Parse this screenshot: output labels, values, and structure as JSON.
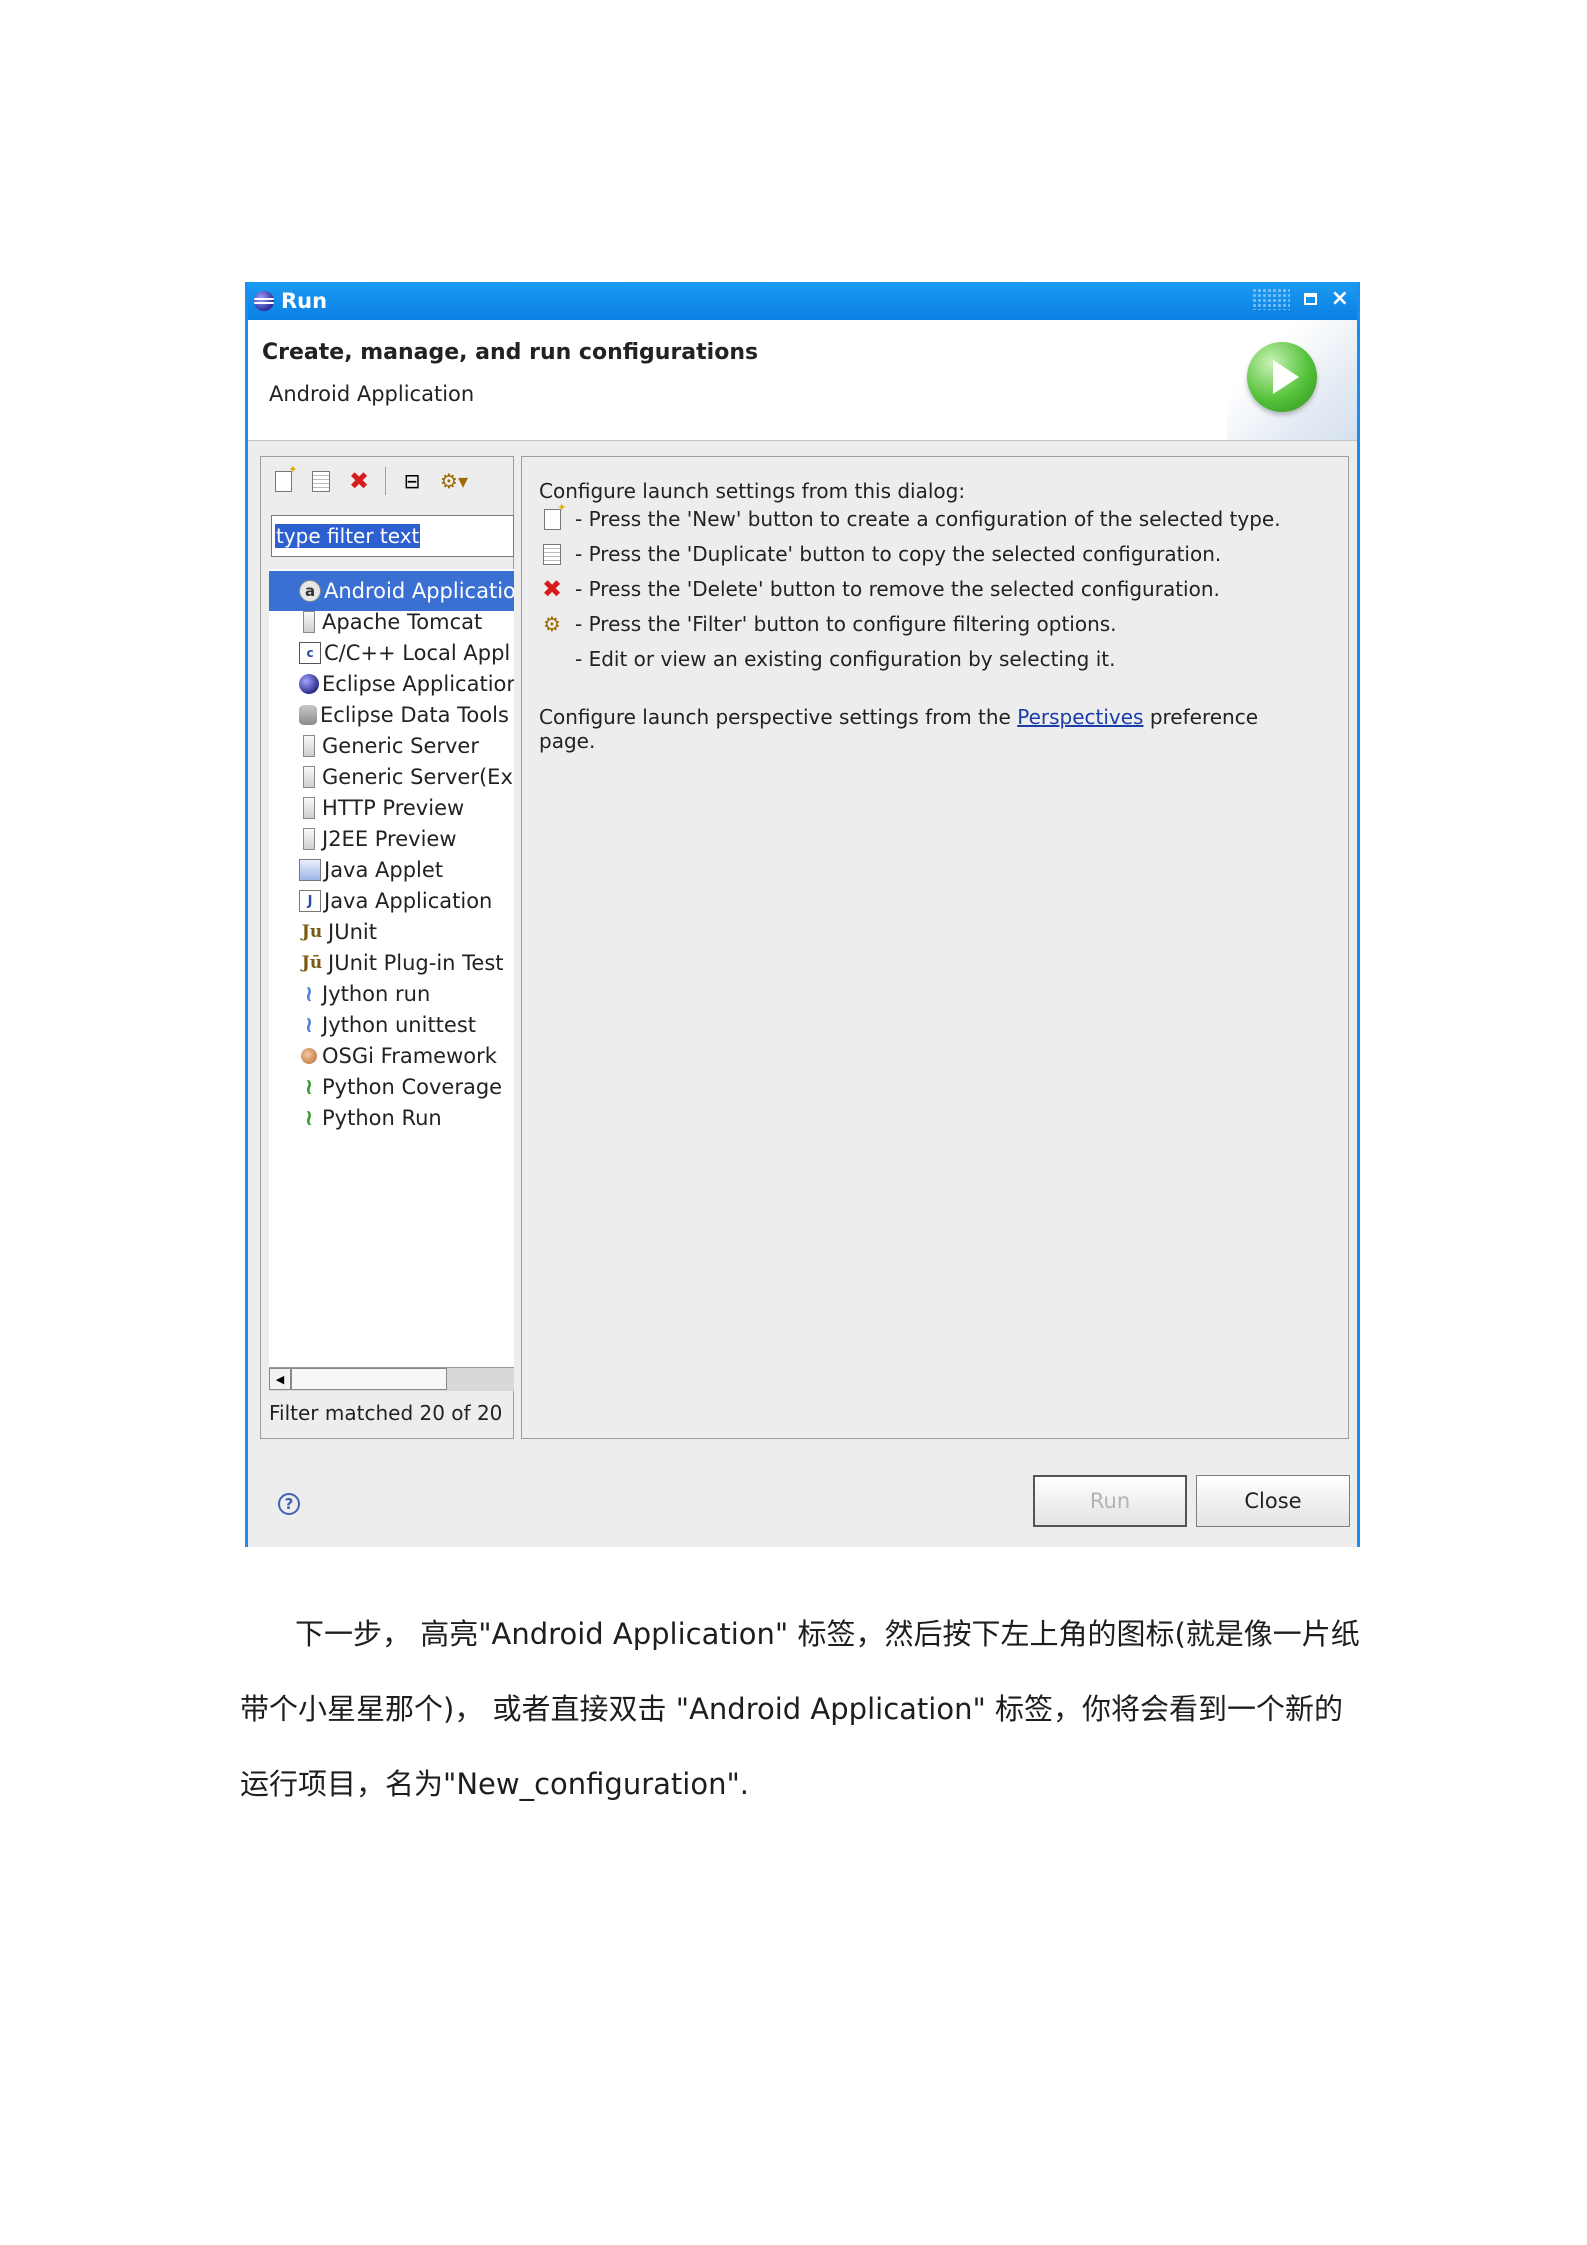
{
  "dialog": {
    "title": "Run",
    "header_title": "Create, manage, and run configurations",
    "header_subtitle": "Android Application",
    "filter_placeholder": "type filter text",
    "tree_items": [
      {
        "label": "Android Applicatio",
        "icon": "android-icon",
        "selected": true
      },
      {
        "label": "Apache Tomcat",
        "icon": "server-icon"
      },
      {
        "label": "C/C++ Local Appl",
        "icon": "c-app-icon"
      },
      {
        "label": "Eclipse Applicatior",
        "icon": "eclipse-icon"
      },
      {
        "label": "Eclipse Data Tools",
        "icon": "database-icon"
      },
      {
        "label": "Generic Server",
        "icon": "server-icon"
      },
      {
        "label": "Generic Server(Ex",
        "icon": "server-icon"
      },
      {
        "label": "HTTP Preview",
        "icon": "server-icon"
      },
      {
        "label": "J2EE Preview",
        "icon": "server-icon"
      },
      {
        "label": "Java Applet",
        "icon": "applet-icon"
      },
      {
        "label": "Java Application",
        "icon": "java-app-icon"
      },
      {
        "label": "JUnit",
        "icon": "junit-icon"
      },
      {
        "label": "JUnit Plug-in Test",
        "icon": "junit-plugin-icon"
      },
      {
        "label": "Jython run",
        "icon": "jython-icon"
      },
      {
        "label": "Jython unittest",
        "icon": "jython-unittest-icon"
      },
      {
        "label": "OSGi Framework",
        "icon": "osgi-icon"
      },
      {
        "label": "Python Coverage",
        "icon": "python-coverage-icon"
      },
      {
        "label": "Python Run",
        "icon": "python-run-icon"
      }
    ],
    "filter_status": "Filter matched 20 of 20",
    "right_panel": {
      "intro": "Configure launch settings from this dialog:",
      "items": [
        {
          "icon": "new-config-icon",
          "text": "- Press the 'New' button to create a configuration of the selected type."
        },
        {
          "icon": "duplicate-icon",
          "text": "- Press the 'Duplicate' button to copy the selected configuration."
        },
        {
          "icon": "delete-icon",
          "text": "- Press the 'Delete' button to remove the selected configuration."
        },
        {
          "icon": "filter-icon",
          "text": "- Press the 'Filter' button to configure filtering options."
        },
        {
          "icon": "",
          "text": "- Edit or view an existing configuration by selecting it."
        }
      ],
      "perspective_pre": "Configure launch perspective settings from the ",
      "perspective_link": "Perspectives",
      "perspective_post": " preference",
      "perspective_line2": "page."
    },
    "buttons": {
      "run": "Run",
      "close": "Close"
    }
  },
  "paragraph": {
    "line1": "下一步， 高亮\"Android Application\" 标签，然后按下左上角的图标(就是像一片纸",
    "line2": "带个小星星那个)， 或者直接双击 \"Android Application\" 标签，你将会看到一个新的",
    "line3": "运行项目，名为\"New_configuration\"."
  }
}
